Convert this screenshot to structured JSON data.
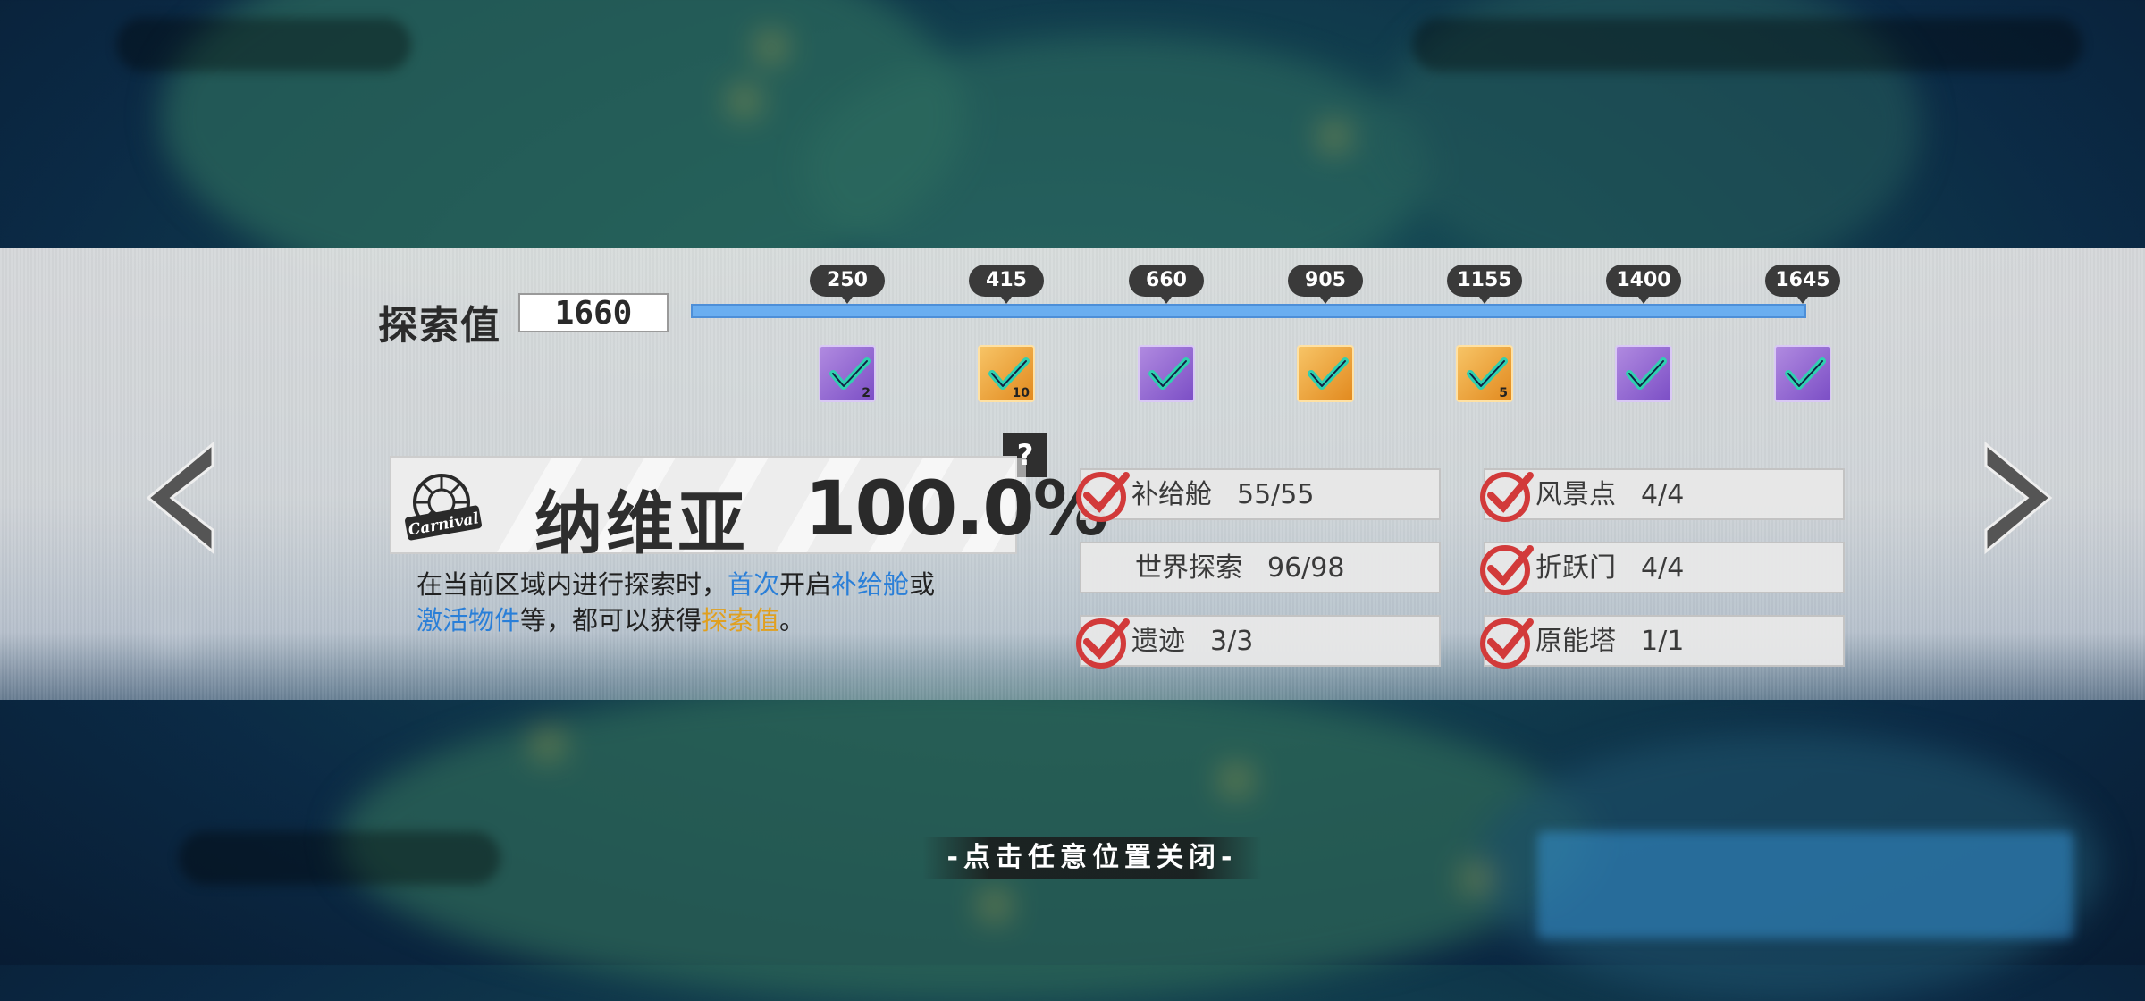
{
  "exploration": {
    "label": "探索值",
    "value": "1660",
    "progress_max": 1645,
    "milestones": [
      {
        "value": "250",
        "reward_color": "purple",
        "count": "2",
        "icon": "gift-icon"
      },
      {
        "value": "415",
        "reward_color": "gold",
        "count": "10",
        "icon": "crystal-icon"
      },
      {
        "value": "660",
        "reward_color": "purple",
        "count": "",
        "icon": "material-icon"
      },
      {
        "value": "905",
        "reward_color": "gold",
        "count": "",
        "icon": "chip-icon"
      },
      {
        "value": "1155",
        "reward_color": "gold",
        "count": "5",
        "icon": "sun-icon"
      },
      {
        "value": "1400",
        "reward_color": "purple",
        "count": "",
        "icon": "outfit-icon"
      },
      {
        "value": "1645",
        "reward_color": "purple",
        "count": "",
        "icon": "gem-icon"
      }
    ]
  },
  "region": {
    "name": "纳维亚",
    "percent": "100.0%",
    "help": "?",
    "logo_text": "Carnival"
  },
  "description": {
    "p1": "在当前区域内进行探索时，",
    "h1": "首次",
    "p2": "开启",
    "h2": "补给舱",
    "p3": "或",
    "h3": "激活物件",
    "p4": "等，都可以获得",
    "h4": "探索值",
    "p5": "。"
  },
  "stats": [
    {
      "label": "补给舱",
      "value": "55/55",
      "done": true
    },
    {
      "label": "风景点",
      "value": "4/4",
      "done": true
    },
    {
      "label": "世界探索",
      "value": "96/98",
      "done": false
    },
    {
      "label": "折跃门",
      "value": "4/4",
      "done": true
    },
    {
      "label": "遗迹",
      "value": "3/3",
      "done": true
    },
    {
      "label": "原能塔",
      "value": "1/1",
      "done": true
    }
  ],
  "close_hint": "-点击任意位置关闭-",
  "colors": {
    "progress": "#6aaef0",
    "check": "#d23a3a",
    "highlight_blue": "#2a7fd8",
    "highlight_gold": "#e0a020"
  }
}
